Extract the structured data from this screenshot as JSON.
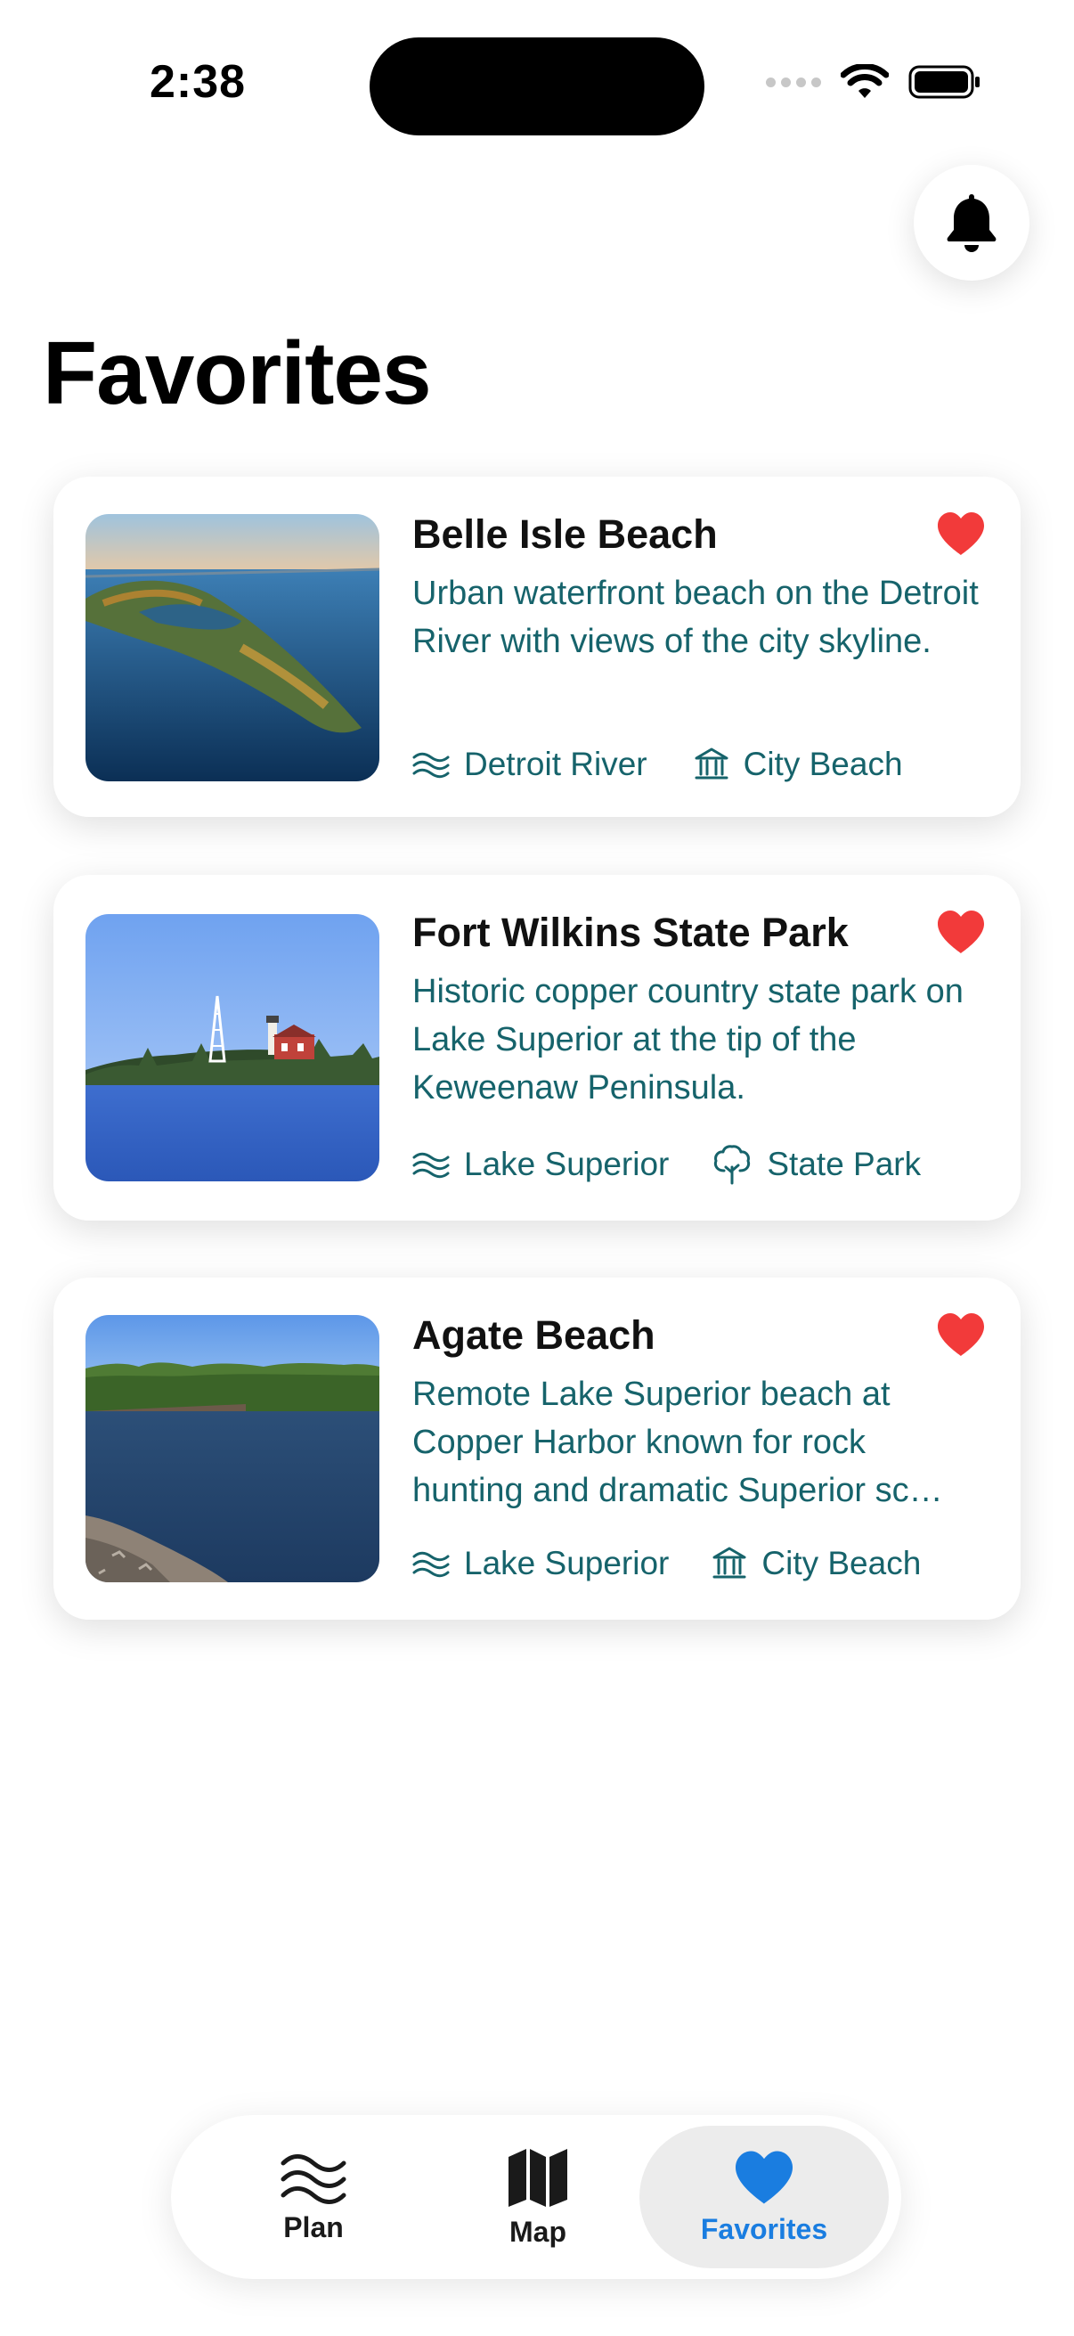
{
  "status_bar": {
    "time": "2:38"
  },
  "header": {
    "title": "Favorites"
  },
  "favorites": [
    {
      "title": "Belle Isle Beach",
      "description": "Urban waterfront beach on the Detroit River with views of the city skyline.",
      "water_body": "Detroit River",
      "water_icon": "water-waves-icon",
      "type": "City Beach",
      "type_icon": "building-columns-icon"
    },
    {
      "title": "Fort Wilkins State Park",
      "description": "Historic copper country state park on Lake Superior at the tip of the Keweenaw Peninsula.",
      "water_body": "Lake Superior",
      "water_icon": "water-waves-icon",
      "type": "State Park",
      "type_icon": "tree-icon"
    },
    {
      "title": "Agate Beach",
      "description": "Remote Lake Superior beach at Copper Harbor known for rock hunting and dramatic Superior sc…",
      "water_body": "Lake Superior",
      "water_icon": "water-waves-icon",
      "type": "City Beach",
      "type_icon": "building-columns-icon"
    }
  ],
  "tabbar": {
    "tabs": [
      {
        "label": "Plan",
        "icon": "water-waves-icon"
      },
      {
        "label": "Map",
        "icon": "map-icon"
      },
      {
        "label": "Favorites",
        "icon": "heart-icon",
        "active": true
      }
    ]
  },
  "colors": {
    "accent_text": "#16636b",
    "heart_red": "#f23a3a",
    "active_tab_blue": "#1a7de0"
  }
}
